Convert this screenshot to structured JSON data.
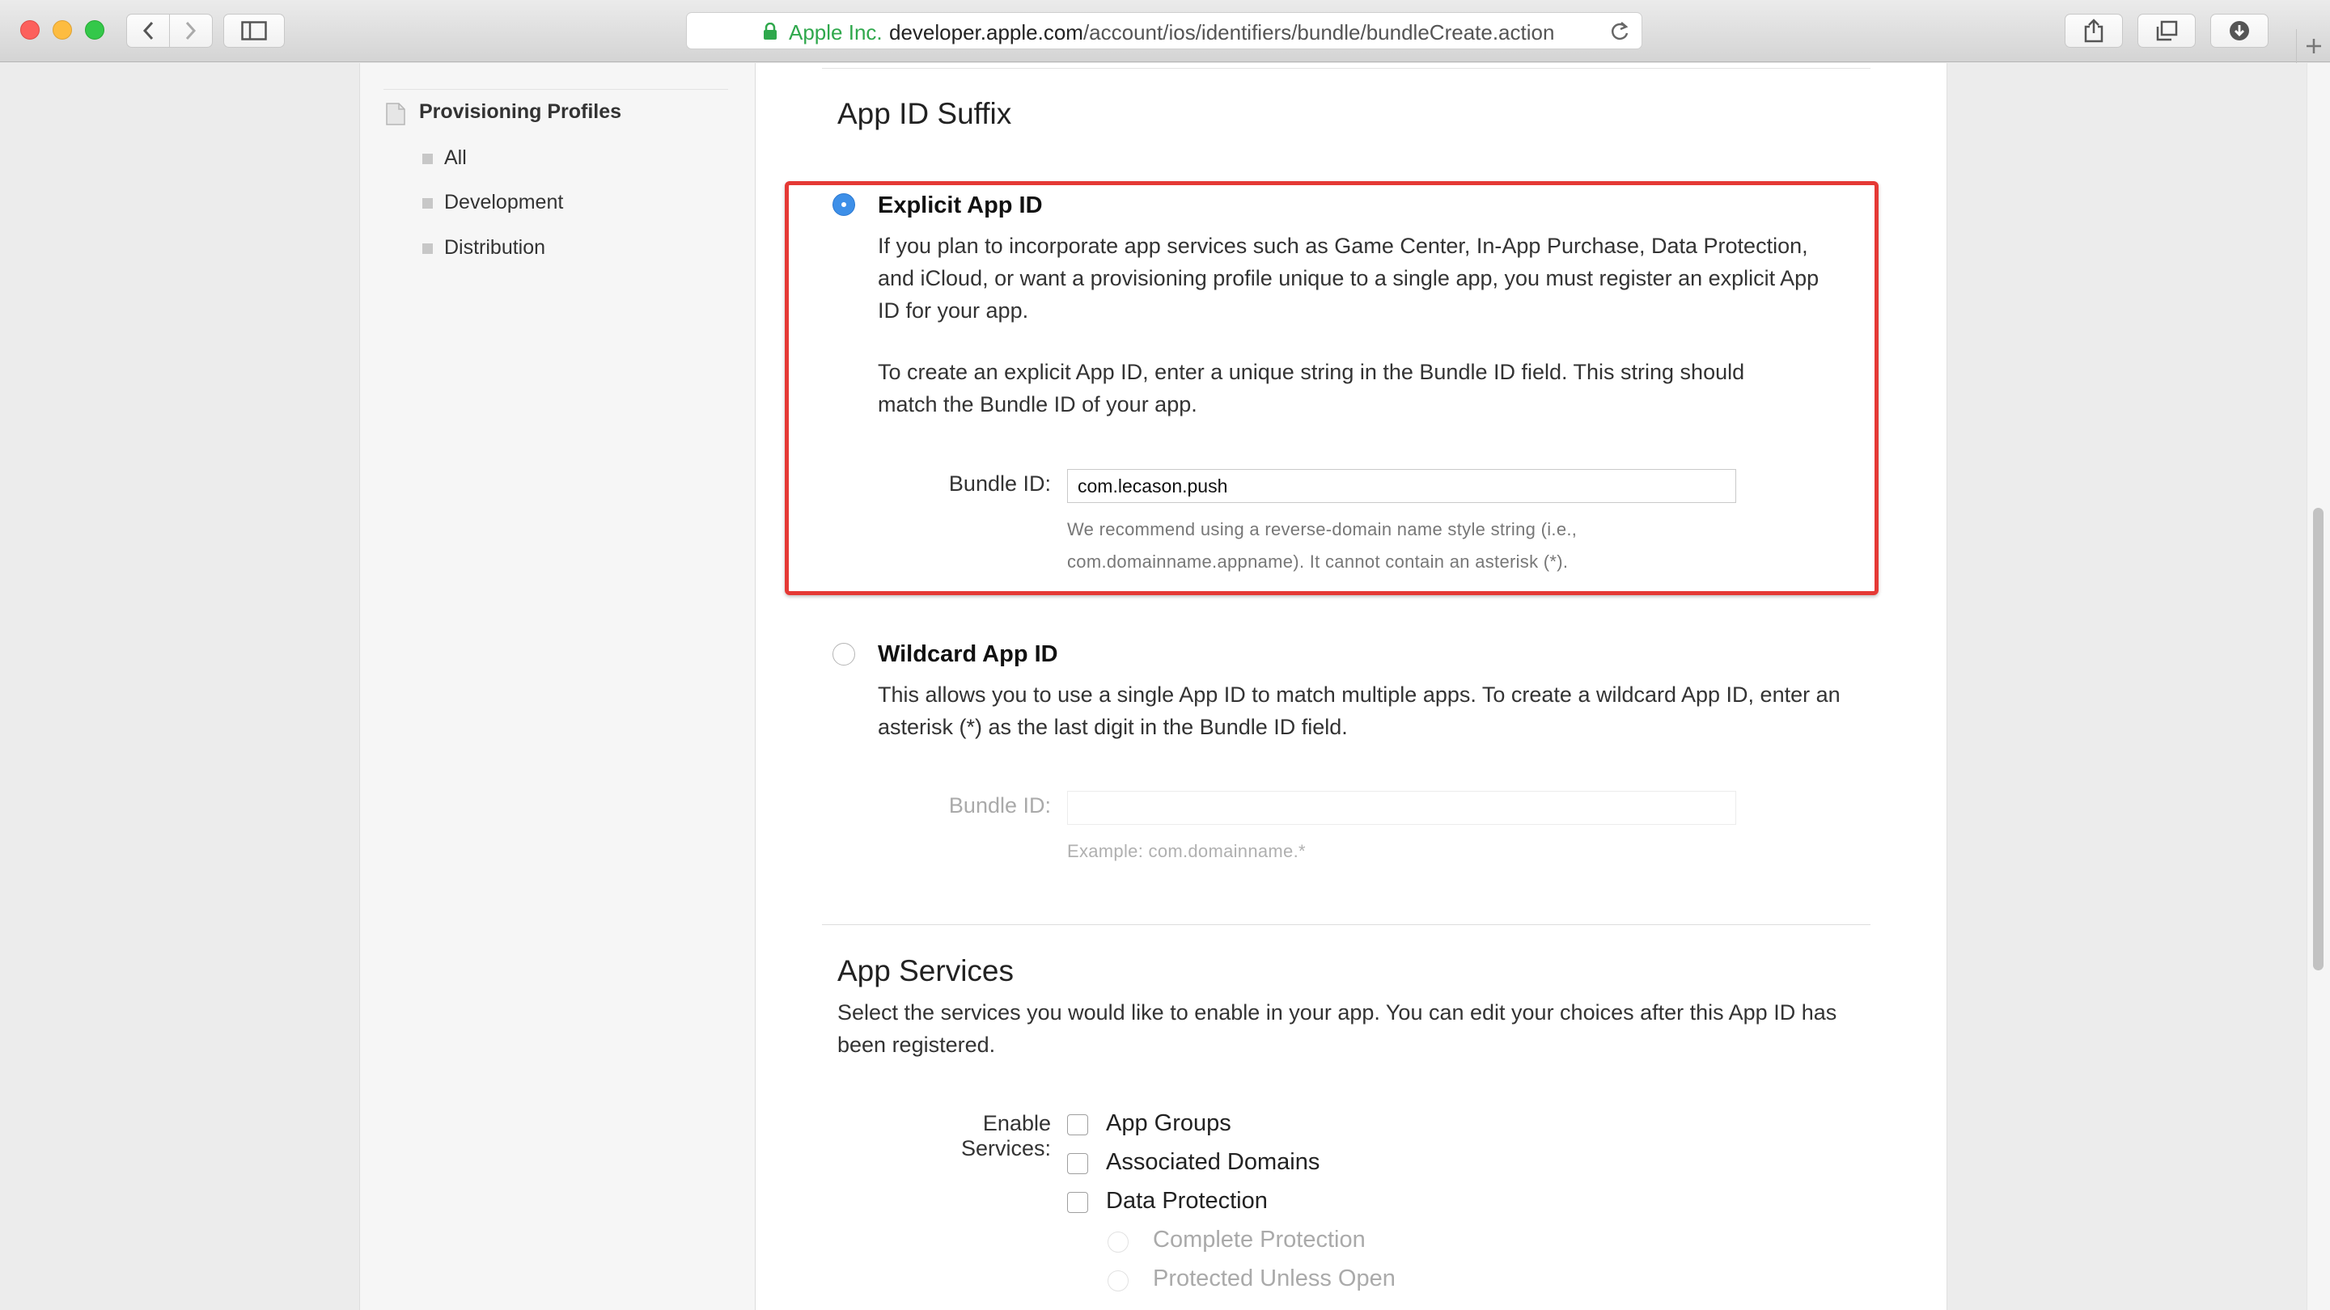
{
  "browser": {
    "address_org": "Apple Inc.",
    "address_host": "developer.apple.com",
    "address_path": "/account/ios/identifiers/bundle/bundleCreate.action"
  },
  "sidebar": {
    "section_title": "Provisioning Profiles",
    "items": [
      {
        "label": "All"
      },
      {
        "label": "Development"
      },
      {
        "label": "Distribution"
      }
    ]
  },
  "app_id_suffix": {
    "heading": "App ID Suffix",
    "explicit": {
      "title": "Explicit App ID",
      "description_1": "If you plan to incorporate app services such as Game Center, In-App Purchase, Data Protection, and iCloud, or want a provisioning profile unique to a single app, you must register an explicit App ID for your app.",
      "description_2": "To create an explicit App ID, enter a unique string in the Bundle ID field. This string should match the Bundle ID of your app.",
      "bundle_label": "Bundle ID:",
      "bundle_value": "com.lecason.push",
      "hint": "We recommend using a reverse-domain name style string (i.e., com.domainname.appname). It cannot contain an asterisk (*).",
      "selected": true
    },
    "wildcard": {
      "title": "Wildcard App ID",
      "description": "This allows you to use a single App ID to match multiple apps. To create a wildcard App ID, enter an asterisk (*) as the last digit in the Bundle ID field.",
      "bundle_label": "Bundle ID:",
      "bundle_value": "",
      "hint": "Example: com.domainname.*",
      "selected": false
    }
  },
  "app_services": {
    "heading": "App Services",
    "description": "Select the services you would like to enable in your app. You can edit your choices after this App ID has been registered.",
    "enable_label": "Enable Services:",
    "services": [
      {
        "label": "App Groups",
        "checked": false
      },
      {
        "label": "Associated Domains",
        "checked": false
      },
      {
        "label": "Data Protection",
        "checked": false
      }
    ],
    "data_protection_options": [
      {
        "label": "Complete Protection"
      },
      {
        "label": "Protected Unless Open"
      }
    ]
  },
  "colors": {
    "highlight": "#e53935",
    "radio_selected": "#3d8fe8",
    "secure_green": "#2fa84c"
  }
}
